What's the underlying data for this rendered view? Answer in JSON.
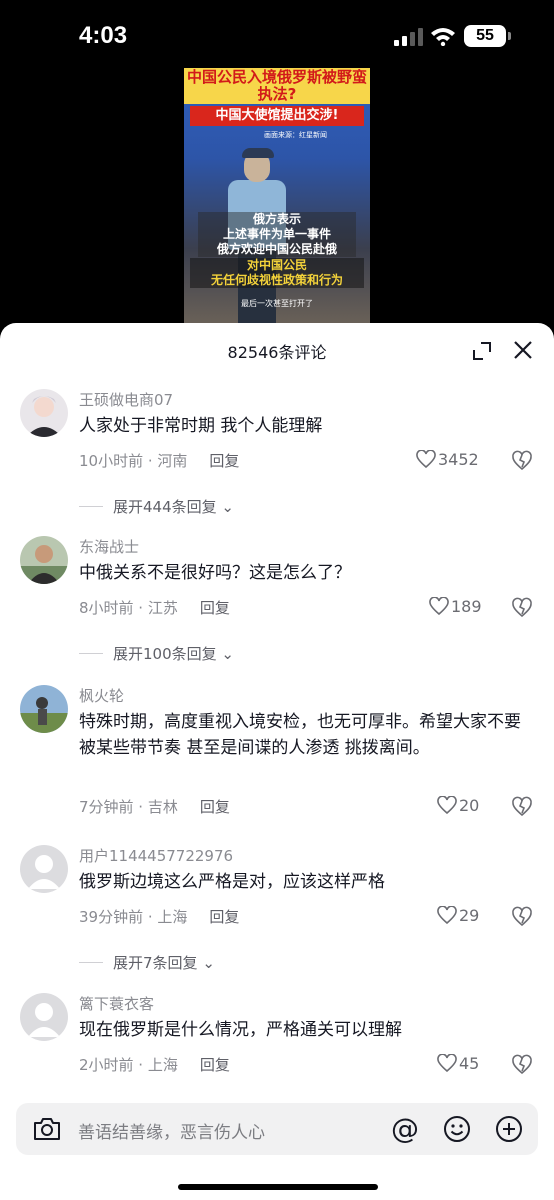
{
  "status": {
    "time": "4:03",
    "battery": "55"
  },
  "video": {
    "title": "中国公民入境俄罗斯被野蛮执法?",
    "subtitle": "中国大使馆提出交涉!",
    "source": "画面来源：红星新闻",
    "overlay_lines": [
      "俄方表示",
      "上述事件为单一事件",
      "俄方欢迎中国公民赴俄"
    ],
    "overlay_highlight": [
      "对中国公民",
      "无任何歧视性政策和行为"
    ],
    "caption": "最后一次甚至打开了"
  },
  "sheet": {
    "title": "82546条评论"
  },
  "comments": [
    {
      "user": "王硕做电商07",
      "text": "人家处于非常时期 我个人能理解",
      "time": "10小时前 · 河南",
      "reply": "回复",
      "likes": "3452",
      "expand": "展开444条回复"
    },
    {
      "user": "东海战士",
      "text": "中俄关系不是很好吗？这是怎么了？",
      "time": "8小时前 · 江苏",
      "reply": "回复",
      "likes": "189",
      "expand": "展开100条回复"
    },
    {
      "user": "枫火轮",
      "text": "特殊时期，高度重视入境安检，也无可厚非。希望大家不要被某些带节奏 甚至是间谍的人渗透 挑拨离间。",
      "time": "7分钟前 · 吉林",
      "reply": "回复",
      "likes": "20"
    },
    {
      "user": "用户1144457722976",
      "text": "俄罗斯边境这么严格是对，应该这样严格",
      "time": "39分钟前 · 上海",
      "reply": "回复",
      "likes": "29",
      "expand": "展开7条回复"
    },
    {
      "user": "篱下蓑衣客",
      "text": "现在俄罗斯是什么情况，严格通关可以理解",
      "time": "2小时前 · 上海",
      "reply": "回复",
      "likes": "45"
    }
  ],
  "input": {
    "placeholder": "善语结善缘，恶言伤人心",
    "at_symbol": "@"
  },
  "colors": {
    "sheet_bg": "#ffffff",
    "text_primary": "#161823",
    "text_secondary": "#8a8b91",
    "input_bg": "#f1f1f2"
  },
  "icons": [
    "signal-icon",
    "wifi-icon",
    "battery-icon",
    "expand-icon",
    "close-icon",
    "heart-icon",
    "dislike-icon",
    "camera-icon",
    "at-icon",
    "emoji-icon",
    "plus-icon"
  ]
}
